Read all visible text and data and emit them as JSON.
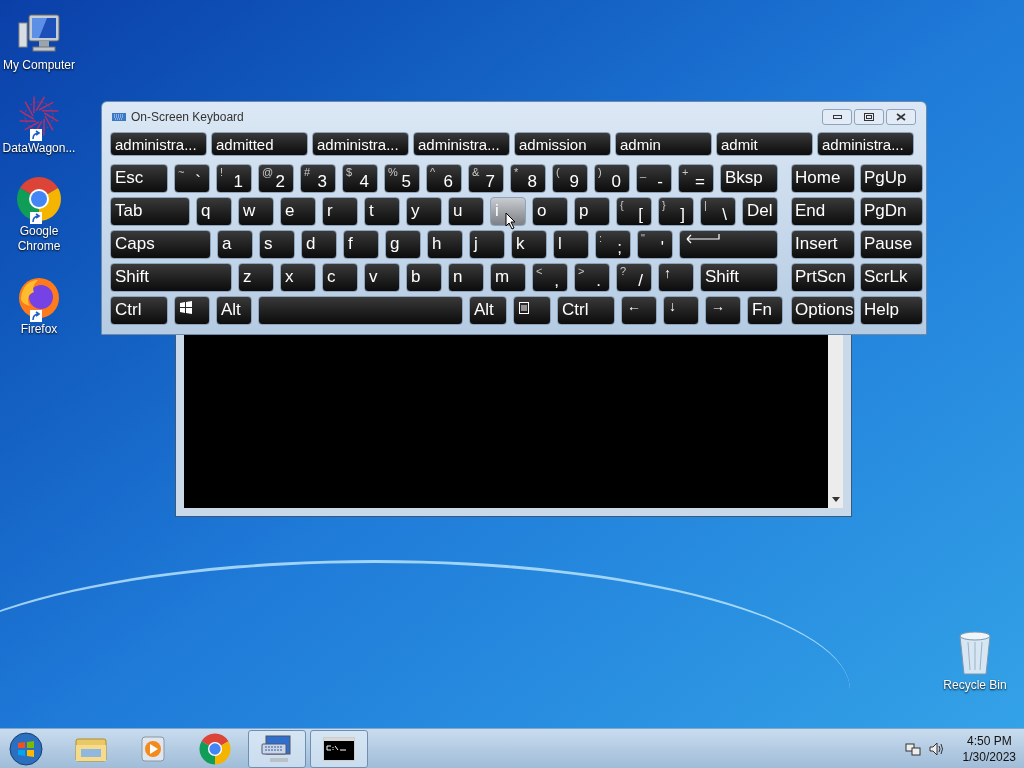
{
  "desktop_icons": [
    {
      "kind": "computer",
      "label": "My Computer"
    },
    {
      "kind": "datawagon",
      "label": "DataWagon..."
    },
    {
      "kind": "chrome",
      "label": "Google Chrome"
    },
    {
      "kind": "firefox",
      "label": "Firefox"
    }
  ],
  "recycle_bin": {
    "label": "Recycle Bin"
  },
  "keyboard": {
    "title": "On-Screen Keyboard",
    "suggestions": [
      "administra...",
      "admitted",
      "administra...",
      "administra...",
      "admission",
      "admin",
      "admit",
      "administra..."
    ],
    "rows": [
      [
        {
          "main": "Esc",
          "hovered": false
        },
        {
          "top": "~",
          "main": "`",
          "hovered": false
        },
        {
          "top": "!",
          "main": "1",
          "hovered": false
        },
        {
          "top": "@",
          "main": "2",
          "hovered": false
        },
        {
          "top": "#",
          "main": "3",
          "hovered": false
        },
        {
          "top": "$",
          "main": "4",
          "hovered": false
        },
        {
          "top": "%",
          "main": "5",
          "hovered": false
        },
        {
          "top": "^",
          "main": "6",
          "hovered": false
        },
        {
          "top": "&",
          "main": "7",
          "hovered": false
        },
        {
          "top": "*",
          "main": "8",
          "hovered": false
        },
        {
          "top": "(",
          "main": "9",
          "hovered": false
        },
        {
          "top": ")",
          "main": "0",
          "hovered": false
        },
        {
          "top": "_",
          "main": "-",
          "hovered": false
        },
        {
          "top": "+",
          "main": "=",
          "hovered": false
        },
        {
          "main": "Bksp",
          "hovered": false
        }
      ],
      [
        {
          "main": "Tab",
          "hovered": false
        },
        {
          "main": "q",
          "hovered": false
        },
        {
          "main": "w",
          "hovered": false
        },
        {
          "main": "e",
          "hovered": false
        },
        {
          "main": "r",
          "hovered": false
        },
        {
          "main": "t",
          "hovered": false
        },
        {
          "main": "y",
          "hovered": false
        },
        {
          "main": "u",
          "hovered": false
        },
        {
          "main": "i",
          "hovered": true
        },
        {
          "main": "o",
          "hovered": false
        },
        {
          "main": "p",
          "hovered": false
        },
        {
          "top": "{",
          "main": "[",
          "hovered": false
        },
        {
          "top": "}",
          "main": "]",
          "hovered": false
        },
        {
          "top": "|",
          "main": "\\",
          "hovered": false
        },
        {
          "main": "Del",
          "hovered": false
        }
      ],
      [
        {
          "main": "Caps",
          "hovered": false
        },
        {
          "main": "a",
          "hovered": false
        },
        {
          "main": "s",
          "hovered": false
        },
        {
          "main": "d",
          "hovered": false
        },
        {
          "main": "f",
          "hovered": false
        },
        {
          "main": "g",
          "hovered": false
        },
        {
          "main": "h",
          "hovered": false
        },
        {
          "main": "j",
          "hovered": false
        },
        {
          "main": "k",
          "hovered": false
        },
        {
          "main": "l",
          "hovered": false
        },
        {
          "top": ":",
          "main": ";",
          "hovered": false
        },
        {
          "top": "\"",
          "main": "'",
          "hovered": false
        },
        {
          "kind": "enter",
          "hovered": false
        }
      ],
      [
        {
          "main": "Shift",
          "hovered": false
        },
        {
          "main": "z",
          "hovered": false
        },
        {
          "main": "x",
          "hovered": false
        },
        {
          "main": "c",
          "hovered": false
        },
        {
          "main": "v",
          "hovered": false
        },
        {
          "main": "b",
          "hovered": false
        },
        {
          "main": "n",
          "hovered": false
        },
        {
          "main": "m",
          "hovered": false
        },
        {
          "top": "<",
          "main": ",",
          "hovered": false
        },
        {
          "top": ">",
          "main": ".",
          "hovered": false
        },
        {
          "top": "?",
          "main": "/",
          "hovered": false
        },
        {
          "top": "↑",
          "hovered": false
        },
        {
          "main": "Shift",
          "hovered": false
        }
      ],
      [
        {
          "main": "Ctrl",
          "hovered": false
        },
        {
          "kind": "windows",
          "hovered": false
        },
        {
          "main": "Alt",
          "hovered": false
        },
        {
          "kind": "space",
          "hovered": false
        },
        {
          "main": "Alt",
          "hovered": false
        },
        {
          "kind": "menu",
          "hovered": false
        },
        {
          "main": "Ctrl",
          "hovered": false
        },
        {
          "top": "←",
          "hovered": false
        },
        {
          "top": "↓",
          "hovered": false
        },
        {
          "top": "→",
          "hovered": false
        },
        {
          "main": "Fn",
          "hovered": false
        }
      ]
    ],
    "nav_keys": [
      {
        "main": "Home"
      },
      {
        "main": "PgUp"
      },
      {
        "main": "End"
      },
      {
        "main": "PgDn"
      },
      {
        "main": "Insert"
      },
      {
        "main": "Pause"
      },
      {
        "main": "PrtScn"
      },
      {
        "main": "ScrLk"
      },
      {
        "main": "Options"
      },
      {
        "main": "Help"
      }
    ]
  },
  "taskbar": {
    "items": [
      {
        "kind": "explorer",
        "active": false
      },
      {
        "kind": "media",
        "active": false
      },
      {
        "kind": "chrome",
        "active": false
      },
      {
        "kind": "keyboard",
        "active": true
      },
      {
        "kind": "console",
        "active": true
      }
    ],
    "time": "4:50 PM",
    "date": "1/30/2023"
  }
}
